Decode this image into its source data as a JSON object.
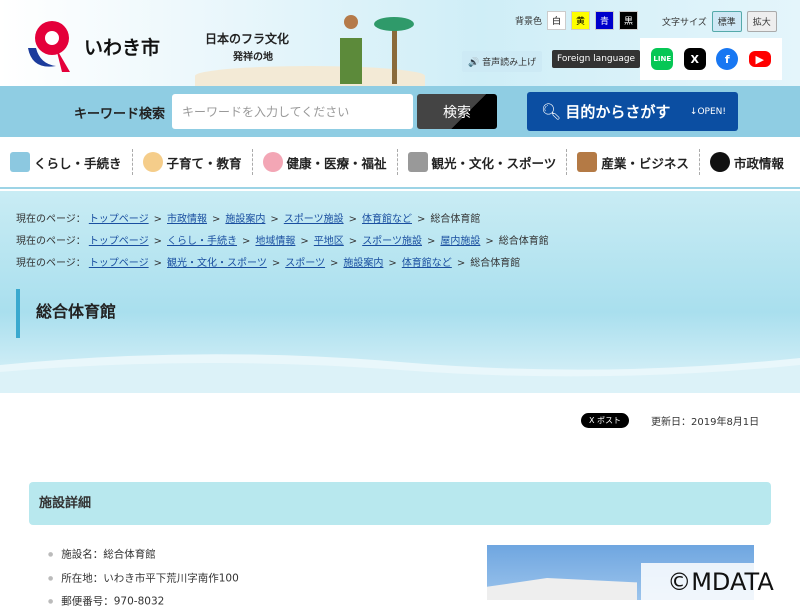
{
  "header": {
    "logo_text": "いわき市",
    "banner_line1": "日本のフラ文化",
    "banner_line2": "発祥の地",
    "bg_color_label": "背景色",
    "bg_colors": [
      {
        "label": "白",
        "bg": "#ffffff",
        "fg": "#000"
      },
      {
        "label": "黄",
        "bg": "#ffff00",
        "fg": "#000"
      },
      {
        "label": "青",
        "bg": "#0000cc",
        "fg": "#fff"
      },
      {
        "label": "黒",
        "bg": "#000000",
        "fg": "#fff"
      }
    ],
    "font_size_label": "文字サイズ",
    "font_standard": "標準",
    "font_large": "拡大",
    "voice_label": "音声読み上げ",
    "foreign_label": "Foreign language",
    "social": [
      "LINE",
      "X",
      "f",
      "▶"
    ]
  },
  "search": {
    "label": "キーワード検索",
    "placeholder": "キーワードを入力してください",
    "button": "検索",
    "purpose_label": "目的からさがす",
    "purpose_open": "↓OPEN!"
  },
  "nav": [
    "くらし・手続き",
    "子育て・教育",
    "健康・医療・福祉",
    "観光・文化・スポーツ",
    "産業・ビジネス",
    "市政情報"
  ],
  "breadcrumbs": [
    {
      "prefix": "現在のページ：",
      "links": [
        "トップページ",
        "市政情報",
        "施設案内",
        "スポーツ施設",
        "体育館など"
      ],
      "current": "総合体育館"
    },
    {
      "prefix": "現在のページ：",
      "links": [
        "トップページ",
        "くらし・手続き",
        "地域情報",
        "平地区",
        "スポーツ施設",
        "屋内施設"
      ],
      "current": "総合体育館"
    },
    {
      "prefix": "現在のページ：",
      "links": [
        "トップページ",
        "観光・文化・スポーツ",
        "スポーツ",
        "施設案内",
        "体育館など"
      ],
      "current": "総合体育館"
    }
  ],
  "page_title": "総合体育館",
  "x_post": "X ポスト",
  "updated": "更新日：2019年8月1日",
  "section_title": "施設詳細",
  "facts": [
    "施設名：総合体育館",
    "所在地：いわき市平下荒川字南作100",
    "郵便番号：970-8032"
  ],
  "watermark": "©MDATA"
}
